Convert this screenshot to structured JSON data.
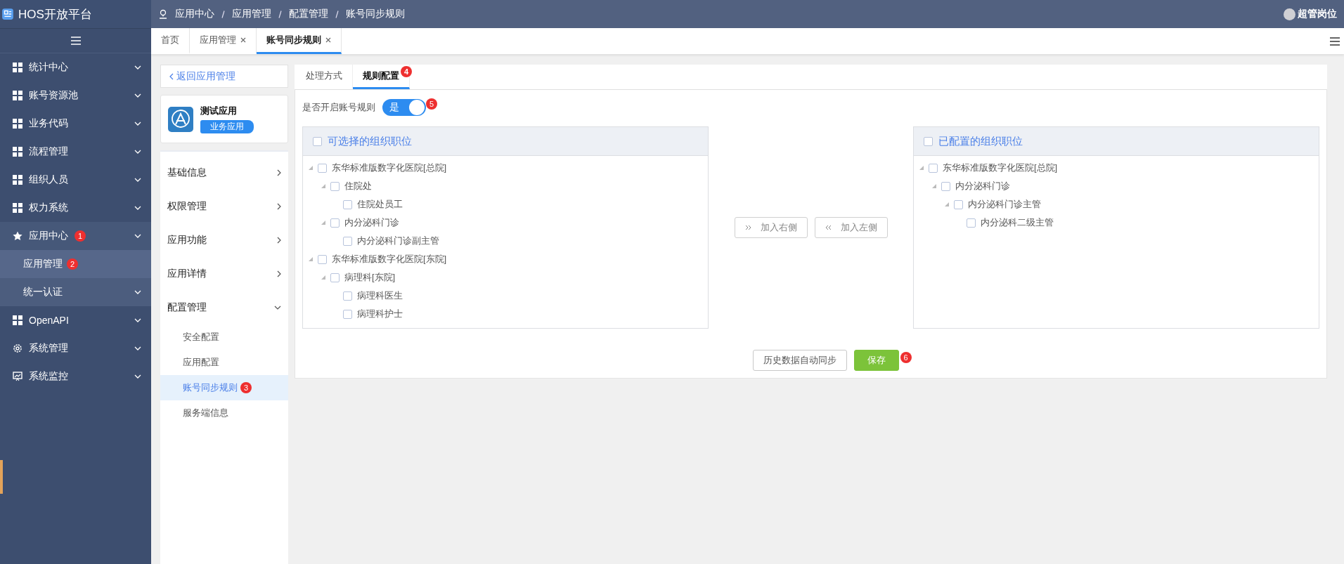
{
  "app": {
    "title": "HOS开放平台"
  },
  "breadcrumb": [
    "应用中心",
    "应用管理",
    "配置管理",
    "账号同步规则"
  ],
  "user": {
    "name": "超管岗位"
  },
  "sidebar": {
    "items": [
      {
        "label": "统计中心",
        "kind": "grid"
      },
      {
        "label": "账号资源池",
        "kind": "grid"
      },
      {
        "label": "业务代码",
        "kind": "grid"
      },
      {
        "label": "流程管理",
        "kind": "grid"
      },
      {
        "label": "组织人员",
        "kind": "grid"
      },
      {
        "label": "权力系统",
        "kind": "grid"
      },
      {
        "label": "应用中心",
        "kind": "star",
        "badge": "1",
        "children": [
          {
            "label": "应用管理",
            "selected": true,
            "badge": "2",
            "kind": "link"
          },
          {
            "label": "统一认证",
            "selected": false,
            "kind": "submenu"
          }
        ]
      },
      {
        "label": "OpenAPI",
        "kind": "grid"
      },
      {
        "label": "系统管理",
        "kind": "gear"
      },
      {
        "label": "系统监控",
        "kind": "monitor"
      }
    ]
  },
  "tabs": [
    {
      "label": "首页",
      "closable": false,
      "selected": false
    },
    {
      "label": "应用管理",
      "closable": true,
      "selected": false
    },
    {
      "label": "账号同步规则",
      "closable": true,
      "selected": true
    }
  ],
  "side_panel": {
    "back_link": "返回应用管理",
    "app_card": {
      "name": "测试应用",
      "tag": "业务应用"
    },
    "menu": [
      {
        "label": "基础信息",
        "expanded": false
      },
      {
        "label": "权限管理",
        "expanded": false
      },
      {
        "label": "应用功能",
        "expanded": false
      },
      {
        "label": "应用详情",
        "expanded": false
      },
      {
        "label": "配置管理",
        "expanded": true,
        "children": [
          {
            "label": "安全配置",
            "selected": false
          },
          {
            "label": "应用配置",
            "selected": false
          },
          {
            "label": "账号同步规则",
            "selected": true,
            "badge": "3"
          },
          {
            "label": "服务端信息",
            "selected": false
          }
        ]
      }
    ]
  },
  "content_tabs": [
    {
      "label": "处理方式",
      "selected": false
    },
    {
      "label": "规则配置",
      "selected": true,
      "badge": "4"
    }
  ],
  "rule_switch": {
    "label": "是否开启账号规则",
    "on": true,
    "text": "是",
    "badge": "5"
  },
  "transfer": {
    "left": {
      "title": "可选择的组织职位",
      "checked": false,
      "tree": [
        {
          "label": "东华标准版数字化医院[总院]",
          "checked": false,
          "expanded": true,
          "children": [
            {
              "label": "住院处",
              "checked": false,
              "expanded": true,
              "children": [
                {
                  "label": "住院处员工",
                  "checked": false
                }
              ]
            },
            {
              "label": "内分泌科门诊",
              "checked": false,
              "expanded": true,
              "children": [
                {
                  "label": "内分泌科门诊副主管",
                  "checked": false
                }
              ]
            }
          ]
        },
        {
          "label": "东华标准版数字化医院[东院]",
          "checked": false,
          "expanded": true,
          "children": [
            {
              "label": "病理科[东院]",
              "checked": false,
              "expanded": true,
              "children": [
                {
                  "label": "病理科医生",
                  "checked": false
                },
                {
                  "label": "病理科护士",
                  "checked": false
                }
              ]
            }
          ]
        }
      ]
    },
    "buttons": [
      {
        "label": "加入右侧",
        "kind": "right"
      },
      {
        "label": "加入左侧",
        "kind": "left"
      }
    ],
    "right": {
      "title": "已配置的组织职位",
      "checked": false,
      "tree": [
        {
          "label": "东华标准版数字化医院[总院]",
          "checked": false,
          "expanded": true,
          "children": [
            {
              "label": "内分泌科门诊",
              "checked": false,
              "expanded": true,
              "children": [
                {
                  "label": "内分泌科门诊主管",
                  "checked": false,
                  "expanded": true,
                  "children": [
                    {
                      "label": "内分泌科二级主管",
                      "checked": false
                    }
                  ]
                }
              ]
            }
          ]
        }
      ]
    }
  },
  "footer_buttons": [
    {
      "label": "历史数据自动同步",
      "kind": "default"
    },
    {
      "label": "保存",
      "kind": "primary",
      "badge": "6"
    }
  ]
}
